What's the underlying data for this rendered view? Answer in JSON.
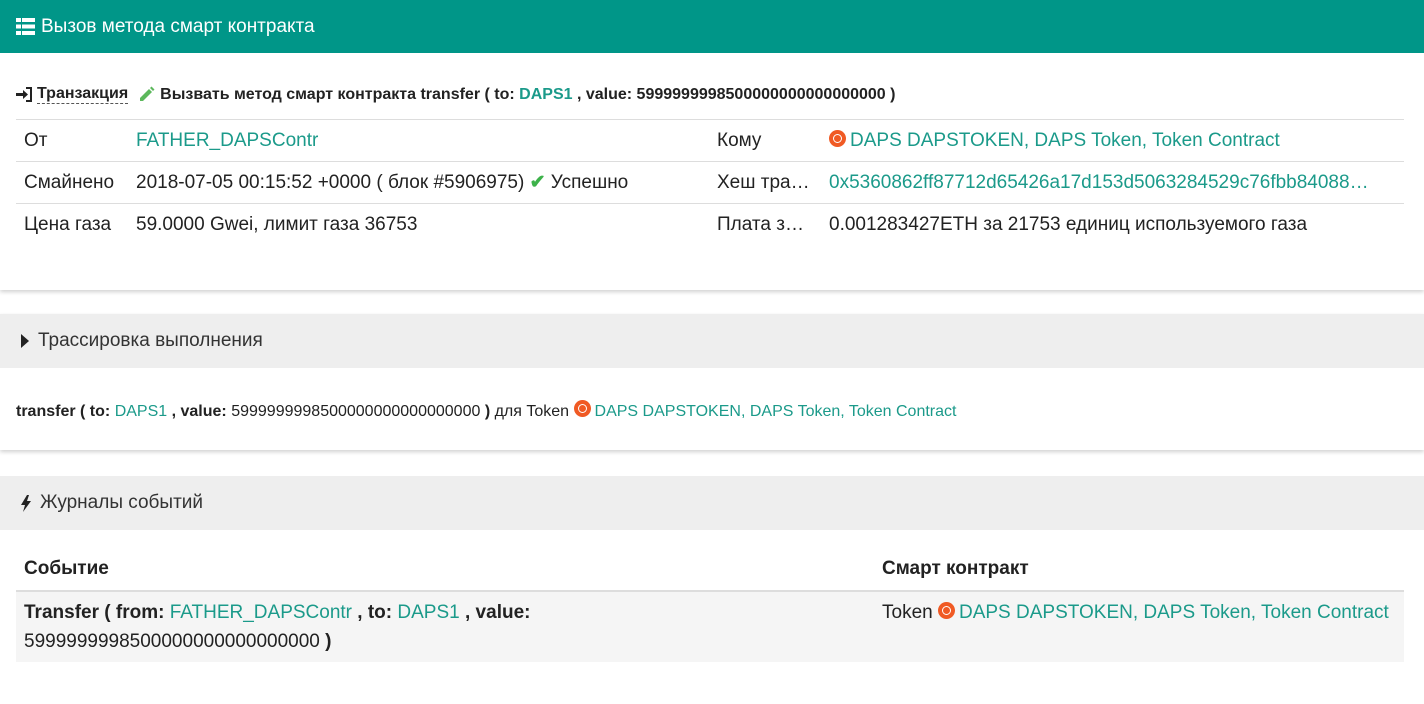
{
  "header": {
    "title": "Вызов метода смарт контракта"
  },
  "transaction": {
    "label": "Транзакция",
    "call_prefix": "Вызвать метод смарт контракта transfer ( to:",
    "to_link": "DAPS1",
    "value_part": ", value: 5999999998500000000000000000 )"
  },
  "info": {
    "from_label": "От",
    "from_value": "FATHER_DAPSContr",
    "to_label": "Кому",
    "to_value": "DAPS DAPSTOKEN, DAPS Token, Token Contract",
    "mined_label": "Смайнено",
    "mined_value": "2018-07-05 00:15:52 +0000 ( блок #5906975)",
    "status": "Успешно",
    "hash_label": "Хеш тра…",
    "hash_value": "0x5360862ff87712d65426a17d153d5063284529c76fbb84088…",
    "gas_price_label": "Цена газа",
    "gas_price_value": "59.0000 Gwei, лимит газа 36753",
    "fee_label": "Плата з…",
    "fee_value": "0.001283427ETH за 21753 единиц используемого газа"
  },
  "trace": {
    "title": "Трассировка выполнения",
    "method": "transfer ( to:",
    "to_link": "DAPS1",
    "value_label": ", value:",
    "value": "5999999998500000000000000000",
    "close": ")",
    "for_token": "для Token",
    "token_link": "DAPS DAPSTOKEN, DAPS Token, Token Contract"
  },
  "events": {
    "title": "Журналы событий",
    "col_event": "Событие",
    "col_contract": "Смарт контракт",
    "rows": [
      {
        "event_name": "Transfer ( from:",
        "from_link": "FATHER_DAPSContr",
        "to_label": ", to:",
        "to_link": "DAPS1",
        "value_label": ", value:",
        "value": "5999999998500000000000000000",
        "close": ")",
        "contract_prefix": "Token",
        "contract_link": "DAPS DAPSTOKEN, DAPS Token, Token Contract"
      }
    ]
  },
  "colors": {
    "header_bg": "#009688",
    "link": "#1b9a8a",
    "token_icon": "#f05a24",
    "success": "#3db24a"
  }
}
